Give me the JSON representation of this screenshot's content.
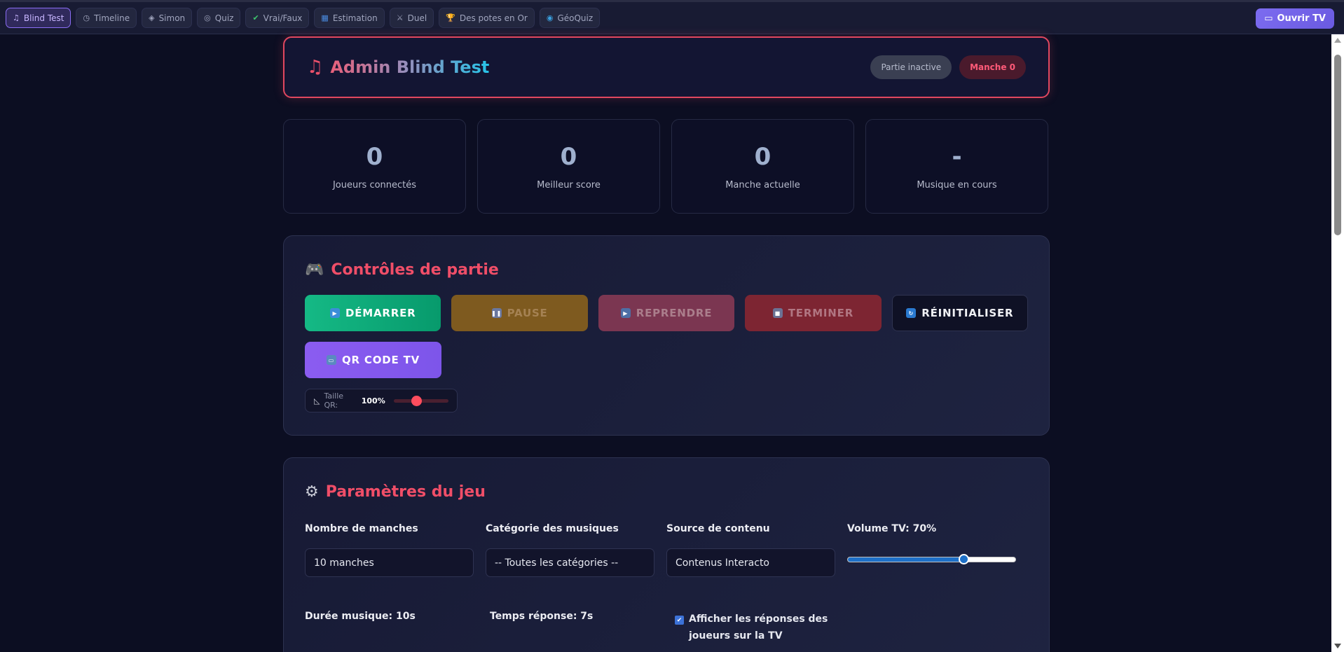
{
  "nav": {
    "tabs": [
      {
        "icon": "♫",
        "label": "Blind Test"
      },
      {
        "icon": "◷",
        "label": "Timeline"
      },
      {
        "icon": "◈",
        "label": "Simon"
      },
      {
        "icon": "◎",
        "label": "Quiz"
      },
      {
        "icon": "✔",
        "label": "Vrai/Faux"
      },
      {
        "icon": "▦",
        "label": "Estimation"
      },
      {
        "icon": "⚔",
        "label": "Duel"
      },
      {
        "icon": "🏆",
        "label": "Des potes en Or"
      },
      {
        "icon": "◉",
        "label": "GéoQuiz"
      }
    ],
    "tv_button": {
      "icon": "▭",
      "label": "Ouvrir TV"
    }
  },
  "header": {
    "icon": "♫",
    "title": "Admin Blind Test",
    "status": "Partie inactive",
    "round": "Manche 0"
  },
  "stats": [
    {
      "value": "0",
      "label": "Joueurs connectés"
    },
    {
      "value": "0",
      "label": "Meilleur score"
    },
    {
      "value": "0",
      "label": "Manche actuelle"
    },
    {
      "value": "-",
      "label": "Musique en cours"
    }
  ],
  "controls": {
    "icon": "🎮",
    "title": "Contrôles de partie",
    "buttons": {
      "start": "DÉMARRER",
      "pause": "PAUSE",
      "resume": "REPRENDRE",
      "stop": "TERMINER",
      "reset": "RÉINITIALISER",
      "qr": "QR CODE TV"
    },
    "qr_size": {
      "label": "Taille QR:",
      "value": "100%",
      "level": 0.37
    }
  },
  "params": {
    "icon": "⚙",
    "title": "Paramètres du jeu",
    "rounds": {
      "label": "Nombre de manches",
      "value": "10 manches"
    },
    "category": {
      "label": "Catégorie des musiques",
      "value": "-- Toutes les catégories --"
    },
    "source": {
      "label": "Source de contenu",
      "value": "Contenus Interacto"
    },
    "volume": {
      "label": "Volume TV: 70%",
      "level": 0.7
    },
    "duration": {
      "label": "Durée musique: 10s"
    },
    "response": {
      "label": "Temps réponse: 7s"
    },
    "show_answers": {
      "label": "Afficher les réponses des joueurs sur la TV",
      "checked": true
    }
  },
  "colors": {
    "accent": "#f04e68",
    "brand_purple": "#8b5cf0",
    "start_green": "#15b985"
  }
}
